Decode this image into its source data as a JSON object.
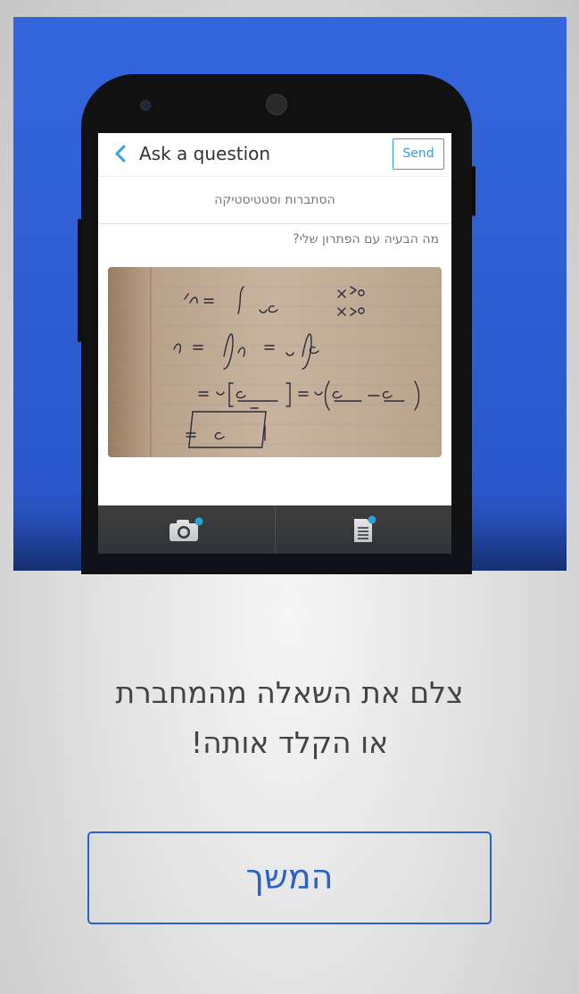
{
  "app": {
    "title": "Ask a question",
    "send_label": "Send",
    "subject": "הסתברות וסטטיסטיקה",
    "question": "מה הבעיה עם הפתרון שלי?",
    "accent_color": "#2ea3dc",
    "toolbar": {
      "left_icon": "camera-add-icon",
      "right_icon": "document-add-icon"
    }
  },
  "onboarding": {
    "line1": "צלם את השאלה מהמחברת",
    "line2": "או הקלד אותה!",
    "continue_label": "המשך",
    "brand_color": "#2b62c7"
  }
}
